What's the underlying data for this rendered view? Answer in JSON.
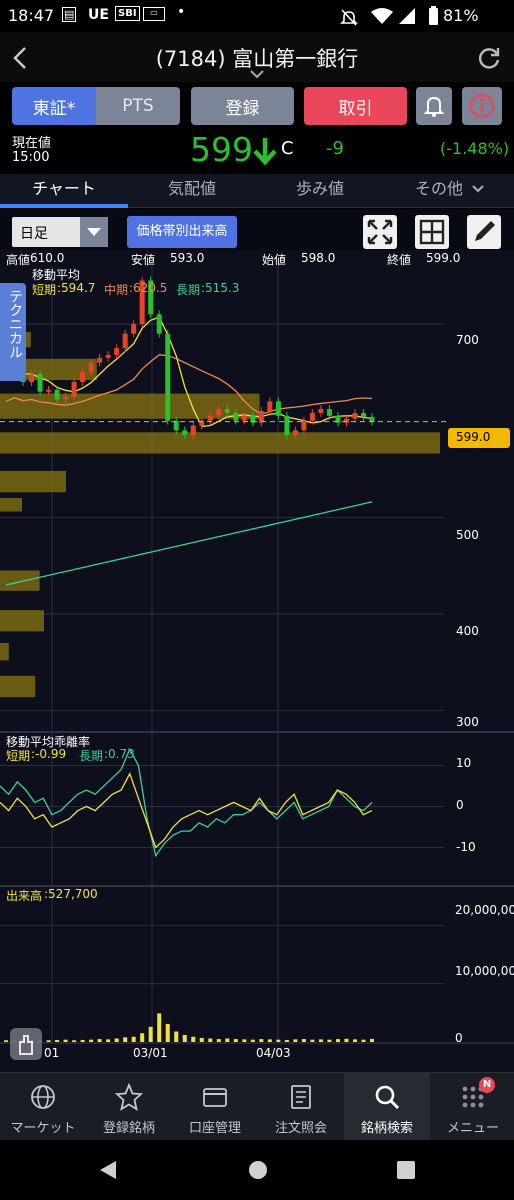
{
  "status_bar": {
    "time": "18:47",
    "apps": [
      "UE",
      "SBI"
    ],
    "battery": "81%"
  },
  "header": {
    "title": "(7184) 富山第一銀行"
  },
  "buttons": {
    "market_primary": "東証*",
    "market_pts": "PTS",
    "register": "登録",
    "trade": "取引"
  },
  "price": {
    "label": "現在値",
    "time": "15:00",
    "value": "599",
    "suffix": "C",
    "change": "-9",
    "change_pct": "(-1.48%)"
  },
  "tabs": [
    "チャート",
    "気配値",
    "歩み値",
    "その他"
  ],
  "toolbar": {
    "period": "日足",
    "volume_button": "価格帯別出来高"
  },
  "ohlc": {
    "high_label": "高値",
    "high": "610.0",
    "low_label": "安値",
    "low": "593.0",
    "open_label": "始値",
    "open": "598.0",
    "close_label": "終値",
    "close": "599.0"
  },
  "ma": {
    "title": "移動平均",
    "short_label": "短期",
    "short_value": ":594.7",
    "mid_label": "中期",
    "mid_value": ":620.5",
    "long_label": "長期",
    "long_value": ":515.3"
  },
  "technical_tab": "テクニカル",
  "price_axis": [
    "700",
    "500",
    "400",
    "300"
  ],
  "last_price_tag": "599.0",
  "deviation": {
    "title": "移動平均乖離率",
    "short_label": "短期",
    "short_value": ":-0.99",
    "long_label": "長期",
    "long_value": ":0.73",
    "axis": [
      "10",
      "0",
      "-10"
    ]
  },
  "volume": {
    "title": "出来高",
    "value": ":527,700",
    "axis": [
      "20,000,000",
      "10,000,000",
      "0"
    ]
  },
  "x_axis": [
    "01",
    "03/01",
    "04/03"
  ],
  "nav": [
    {
      "label": "マーケット",
      "icon": "globe-icon"
    },
    {
      "label": "登録銘柄",
      "icon": "star-icon"
    },
    {
      "label": "口座管理",
      "icon": "card-icon"
    },
    {
      "label": "注文照会",
      "icon": "document-icon"
    },
    {
      "label": "銘柄検索",
      "icon": "search-icon"
    },
    {
      "label": "メニュー",
      "icon": "grid-icon",
      "badge": "N"
    }
  ],
  "colors": {
    "up": "#e8442c",
    "down": "#28c22c",
    "short_ma": "#f4e23a",
    "mid_ma": "#ee8a4c",
    "long_ma": "#3dcf9a",
    "volume_profile": "#7a6a10",
    "accent_blue": "#4f73e0",
    "accent_red": "#e9475b"
  },
  "chart_data": [
    {
      "type": "candlestick",
      "ylabel": "",
      "ylim": [
        280,
        760
      ],
      "y_ticks": [
        700,
        500,
        400,
        300
      ],
      "x_ticks": [
        "01",
        "03/01",
        "04/03"
      ],
      "last_close": 599.0,
      "volume_profile_bands": [
        {
          "price_from": 692,
          "price_to": 676,
          "level": 0.07
        },
        {
          "price_from": 664,
          "price_to": 642,
          "level": 0.22
        },
        {
          "price_from": 628,
          "price_to": 602,
          "level": 0.59
        },
        {
          "price_from": 588,
          "price_to": 566,
          "level": 1.0
        },
        {
          "price_from": 548,
          "price_to": 526,
          "level": 0.15
        },
        {
          "price_from": 520,
          "price_to": 506,
          "level": 0.05
        },
        {
          "price_from": 445,
          "price_to": 424,
          "level": 0.09
        },
        {
          "price_from": 404,
          "price_to": 382,
          "level": 0.1
        },
        {
          "price_from": 370,
          "price_to": 352,
          "level": 0.02
        },
        {
          "price_from": 336,
          "price_to": 314,
          "level": 0.08
        }
      ]
    },
    {
      "type": "line",
      "ylim": [
        -15,
        15
      ],
      "y_ticks": [
        10,
        0,
        -10
      ],
      "series": [
        {
          "name": "短期",
          "values": [
            1,
            -1,
            2,
            0,
            -3,
            -2,
            -5,
            -4,
            -3,
            -1,
            0,
            -1,
            1,
            3,
            4,
            8,
            2,
            -4,
            -10,
            -8,
            -5,
            -3,
            -2,
            -1,
            -2,
            -1,
            0,
            1,
            0,
            -1,
            2,
            -1,
            -2,
            1,
            3,
            -2,
            -1,
            0,
            1,
            4,
            3,
            1,
            -2,
            -1
          ]
        },
        {
          "name": "長期",
          "values": [
            5,
            3,
            6,
            4,
            1,
            2,
            -2,
            -1,
            1,
            3,
            4,
            3,
            5,
            7,
            9,
            14,
            10,
            -3,
            -12,
            -9,
            -7,
            -6,
            -6,
            -4,
            -5,
            -3,
            -4,
            -2,
            -2,
            -1,
            1,
            -1,
            -3,
            -1,
            1,
            -3,
            -2,
            -1,
            0,
            4,
            2,
            0,
            -1,
            1
          ]
        }
      ]
    },
    {
      "type": "bar",
      "ylim": [
        0,
        24000000
      ],
      "y_ticks": [
        20000000,
        10000000,
        0
      ],
      "values": [
        300000,
        200000,
        400000,
        300000,
        250000,
        300000,
        350000,
        400000,
        300000,
        350000,
        400000,
        500000,
        450000,
        600000,
        800000,
        900000,
        1500000,
        2600000,
        4900000,
        3100000,
        1800000,
        1200000,
        900000,
        700000,
        600000,
        500000,
        600000,
        500000,
        450000,
        400000,
        500000,
        450000,
        400000,
        350000,
        450000,
        500000,
        400000,
        450000,
        400000,
        500000,
        550000,
        450000,
        400000,
        527700
      ]
    }
  ]
}
